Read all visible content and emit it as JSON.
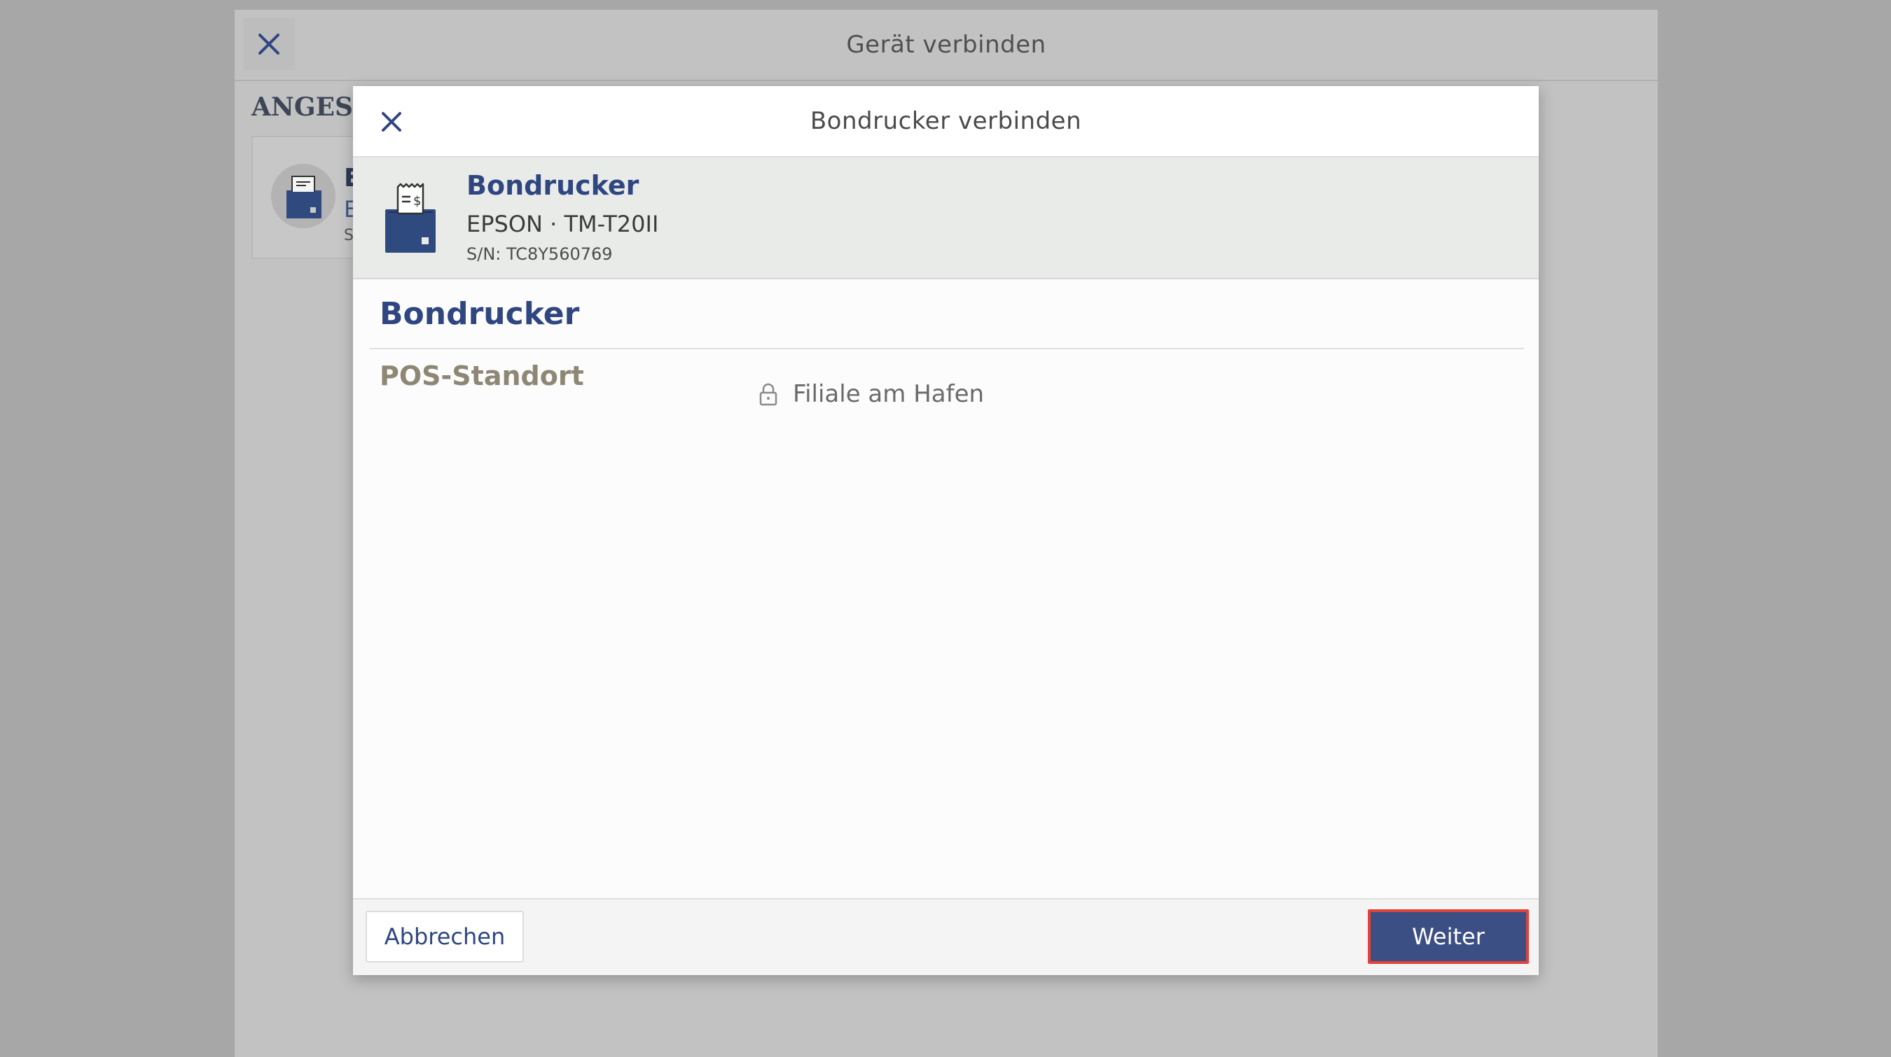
{
  "outer_dialog": {
    "title": "Gerät verbinden",
    "close_icon": "close-icon",
    "section_heading": "ANGESCH",
    "card": {
      "title": "E",
      "subtitle": "E",
      "meta": "S"
    }
  },
  "dialog": {
    "title": "Bondrucker verbinden",
    "close_icon": "close-icon",
    "device": {
      "icon": "receipt-printer-icon",
      "name": "Bondrucker",
      "model": "EPSON · TM-T20II",
      "serial": "S/N: TC8Y560769"
    },
    "section_heading": "Bondrucker",
    "fields": [
      {
        "label": "POS-Standort",
        "value": "Filiale am Hafen",
        "icon": "lock-icon",
        "locked": true
      }
    ],
    "footer": {
      "cancel_label": "Abbrechen",
      "next_label": "Weiter"
    }
  },
  "colors": {
    "accent": "#2f4680",
    "primary_button": "#3c4f84",
    "focus_outline": "#e0433a",
    "backdrop": "#a7a7a7"
  }
}
